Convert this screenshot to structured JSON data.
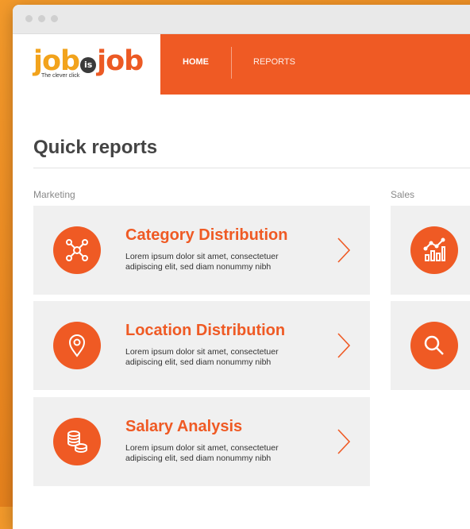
{
  "logo": {
    "part1": "job",
    "middle": "is",
    "part2": "job",
    "tagline": "The clever click"
  },
  "nav": {
    "items": [
      {
        "label": "HOME"
      },
      {
        "label": "REPORTS"
      }
    ]
  },
  "page": {
    "title": "Quick reports"
  },
  "sections": [
    {
      "label": "Marketing",
      "cards": [
        {
          "title": "Category Distribution",
          "description": "Lorem ipsum dolor sit amet, consectetuer adipiscing elit, sed diam nonummy nibh",
          "icon": "network-icon"
        },
        {
          "title": "Location Distribution",
          "description": "Lorem ipsum dolor sit amet, consectetuer adipiscing elit, sed diam nonummy nibh",
          "icon": "location-pin-icon"
        },
        {
          "title": "Salary Analysis",
          "description": "Lorem ipsum dolor sit amet, consectetuer adipiscing elit, sed diam nonummy nibh",
          "icon": "coins-icon"
        }
      ]
    },
    {
      "label": "Sales",
      "cards": [
        {
          "icon": "bar-chart-trend-icon"
        },
        {
          "icon": "search-icon"
        }
      ]
    }
  ],
  "colors": {
    "accent": "#ef5a24",
    "card_bg": "#f0f0f0",
    "logo_yellow": "#f2a31c"
  }
}
